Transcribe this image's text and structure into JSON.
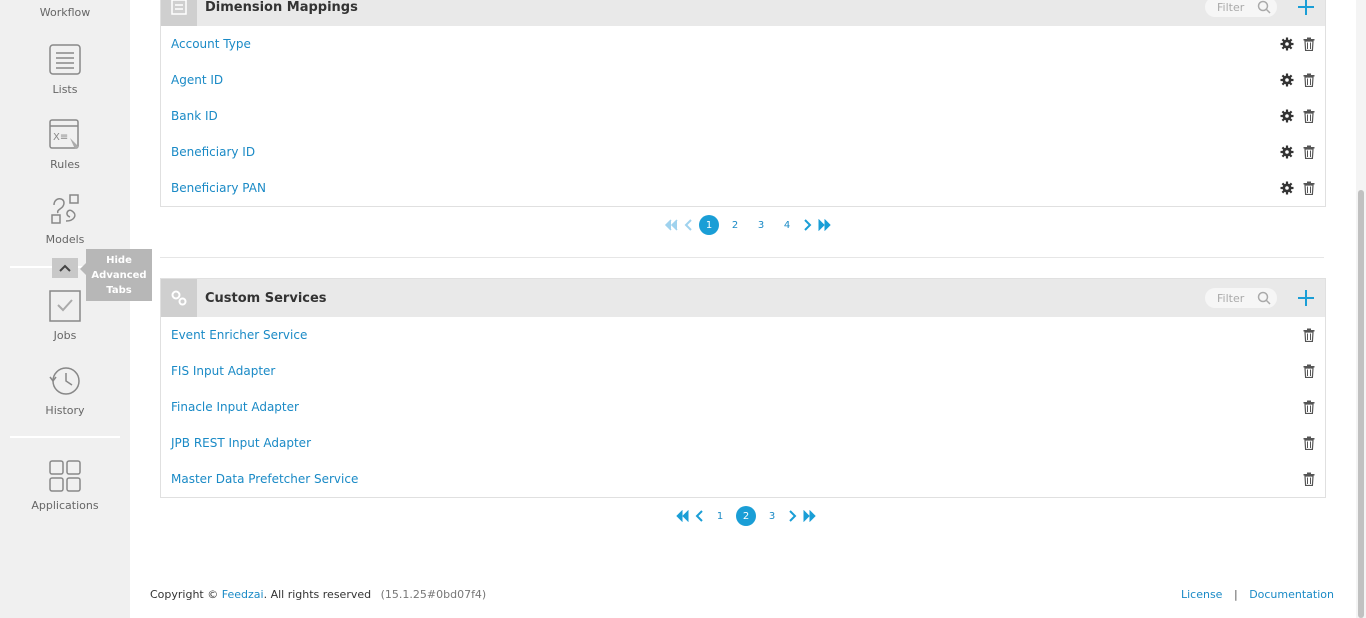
{
  "sidebar": {
    "items": [
      {
        "label": "Workflow",
        "icon": "workflow-icon"
      },
      {
        "label": "Lists",
        "icon": "list-icon"
      },
      {
        "label": "Rules",
        "icon": "rules-icon"
      },
      {
        "label": "Models",
        "icon": "models-icon"
      },
      {
        "label": "Jobs",
        "icon": "jobs-icon"
      },
      {
        "label": "History",
        "icon": "history-icon"
      },
      {
        "label": "Applications",
        "icon": "applications-icon"
      }
    ],
    "tooltip": {
      "line1": "Hide",
      "line2": "Advanced",
      "line3": "Tabs"
    }
  },
  "dimension_mappings": {
    "title": "Dimension Mappings",
    "filter_placeholder": "Filter",
    "rows": [
      "Account Type",
      "Agent ID",
      "Bank ID",
      "Beneficiary ID",
      "Beneficiary PAN"
    ],
    "pagination": {
      "pages": [
        "1",
        "2",
        "3",
        "4"
      ],
      "current": "1"
    }
  },
  "custom_services": {
    "title": "Custom Services",
    "filter_placeholder": "Filter",
    "rows": [
      "Event Enricher Service",
      "FIS Input Adapter",
      "Finacle Input Adapter",
      "JPB REST Input Adapter",
      "Master Data Prefetcher Service"
    ],
    "pagination": {
      "pages": [
        "1",
        "2",
        "3"
      ],
      "current": "2"
    }
  },
  "footer": {
    "copyright": "Copyright ©",
    "company": "Feedzai",
    "rights": ". All rights reserved",
    "version": "(15.1.25#0bd07f4)",
    "license": "License",
    "separator": "|",
    "documentation": "Documentation"
  },
  "colors": {
    "accent": "#1a8ac6",
    "active_page": "#1a9ed6",
    "sidebar_bg": "#f0f0f0",
    "header_bg": "#e9e9e9"
  }
}
